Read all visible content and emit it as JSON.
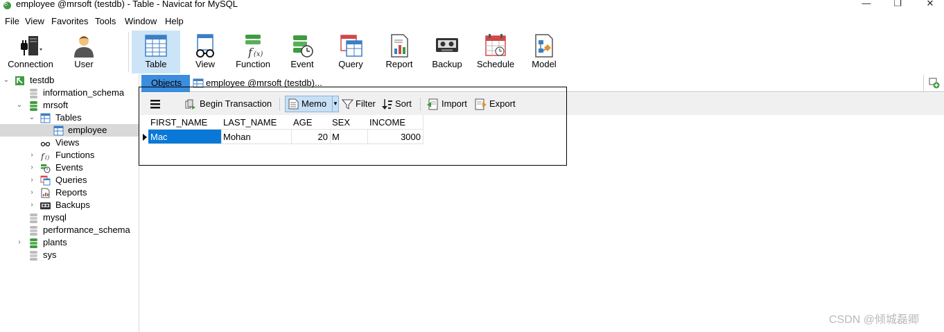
{
  "window": {
    "title": "employee @mrsoft (testdb) - Table - Navicat for MySQL",
    "minimize": "—",
    "maximize": "❐",
    "close": "✕"
  },
  "menu": [
    "File",
    "View",
    "Favorites",
    "Tools",
    "Window",
    "Help"
  ],
  "toolbar": [
    {
      "label": "Connection",
      "icon": "connection-icon"
    },
    {
      "label": "User",
      "icon": "user-icon"
    },
    {
      "label": "Table",
      "icon": "table-icon",
      "active": true
    },
    {
      "label": "View",
      "icon": "view-icon"
    },
    {
      "label": "Function",
      "icon": "function-icon"
    },
    {
      "label": "Event",
      "icon": "event-icon"
    },
    {
      "label": "Query",
      "icon": "query-icon"
    },
    {
      "label": "Report",
      "icon": "report-icon"
    },
    {
      "label": "Backup",
      "icon": "backup-icon"
    },
    {
      "label": "Schedule",
      "icon": "schedule-icon"
    },
    {
      "label": "Model",
      "icon": "model-icon"
    }
  ],
  "tree": [
    {
      "label": "testdb",
      "icon": "connection-icon",
      "expanded": true
    },
    {
      "label": "information_schema",
      "icon": "database-icon"
    },
    {
      "label": "mrsoft",
      "icon": "database-icon",
      "expanded": true
    },
    {
      "label": "Tables",
      "icon": "table-icon",
      "expanded": true
    },
    {
      "label": "employee",
      "icon": "table-icon",
      "selected": true
    },
    {
      "label": "Views",
      "icon": "view-icon"
    },
    {
      "label": "Functions",
      "icon": "function-icon"
    },
    {
      "label": "Events",
      "icon": "event-icon"
    },
    {
      "label": "Queries",
      "icon": "query-icon"
    },
    {
      "label": "Reports",
      "icon": "report-icon"
    },
    {
      "label": "Backups",
      "icon": "backup-icon"
    },
    {
      "label": "mysql",
      "icon": "database-icon"
    },
    {
      "label": "performance_schema",
      "icon": "database-icon"
    },
    {
      "label": "plants",
      "icon": "database-icon"
    },
    {
      "label": "sys",
      "icon": "database-icon"
    }
  ],
  "tabs": {
    "objects": "Objects",
    "employee": "employee @mrsoft (testdb)..."
  },
  "objects_toolbar": {
    "menu_icon": "hamburger-icon",
    "begin_transaction": "Begin Transaction",
    "memo": "Memo",
    "filter": "Filter",
    "sort": "Sort",
    "import": "Import",
    "export": "Export"
  },
  "grid": {
    "columns": [
      "FIRST_NAME",
      "LAST_NAME",
      "AGE",
      "SEX",
      "INCOME"
    ],
    "rows": [
      [
        "Mac",
        "Mohan",
        "20",
        "M",
        "3000"
      ]
    ]
  },
  "colors": {
    "accent": "#3c8dde",
    "selection": "#0a78d7",
    "active_toolbar": "#cce4f7"
  },
  "watermark": "CSDN @倾城磊卿"
}
